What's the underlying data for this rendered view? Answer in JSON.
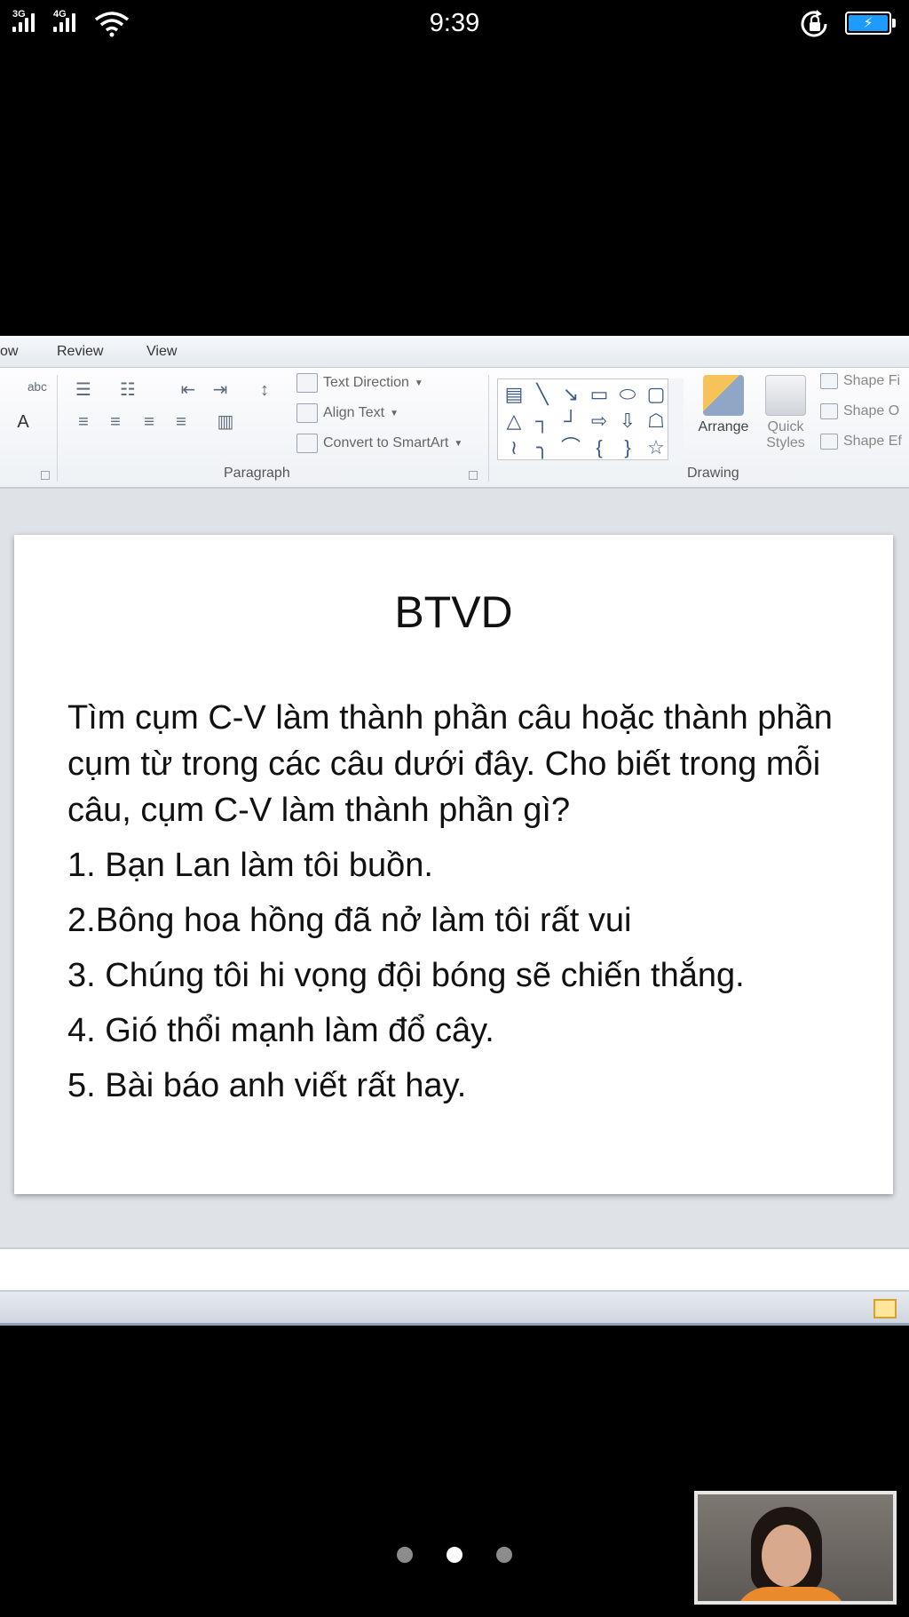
{
  "status_bar": {
    "network_1": "3G",
    "network_2": "4G",
    "time": "9:39",
    "battery_color": "#1e9bff"
  },
  "ribbon": {
    "tabs": [
      "ow",
      "Review",
      "View"
    ],
    "paragraph": {
      "text_direction": "Text Direction",
      "align_text": "Align Text",
      "convert_smartart": "Convert to SmartArt",
      "group_label": "Paragraph"
    },
    "drawing": {
      "arrange": "Arrange",
      "quick_styles_1": "Quick",
      "quick_styles_2": "Styles",
      "shape_fill": "Shape Fi",
      "shape_outline": "Shape O",
      "shape_effects": "Shape Ef",
      "group_label": "Drawing"
    },
    "font_color_glyph": "A"
  },
  "slide": {
    "title": "BTVD",
    "instruction": "Tìm cụm C-V làm thành phần câu hoặc thành phần cụm từ trong các câu dưới đây. Cho biết trong mỗi câu, cụm C-V làm thành phần gì?",
    "items": [
      "1. Bạn Lan làm tôi buồn.",
      "2.Bông hoa hồng đã nở làm tôi rất vui",
      "3. Chúng tôi hi vọng đội bóng sẽ chiến thắng.",
      "4. Gió thổi mạnh làm đổ cây.",
      "5. Bài báo anh viết rất hay."
    ]
  },
  "pager": {
    "count": 3,
    "active_index": 1
  }
}
